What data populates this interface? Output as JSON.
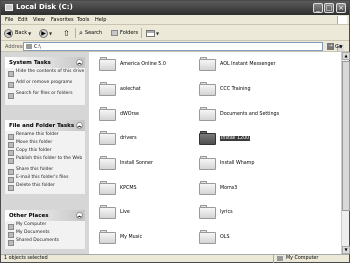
{
  "window": {
    "title": "Local Disk (C:)"
  },
  "window_buttons": {
    "minimize": "_",
    "maximize": "□",
    "close": "×"
  },
  "menu": [
    "File",
    "Edit",
    "View",
    "Favorites",
    "Tools",
    "Help"
  ],
  "toolbar": {
    "back_label": "Back",
    "search_label": "Search",
    "folders_label": "Folders"
  },
  "address": {
    "label": "Address",
    "value": "C:\\",
    "go_label": "Go"
  },
  "tasks": {
    "system": {
      "title": "System Tasks",
      "items": [
        "Hide the contents of this drive",
        "Add or remove programs",
        "Search for files or folders"
      ]
    },
    "file_folder": {
      "title": "File and Folder Tasks",
      "items": [
        "Rename this folder",
        "Move this folder",
        "Copy this folder",
        "Publish this folder to the Web",
        "Share this folder",
        "E-mail this folder's files",
        "Delete this folder"
      ]
    },
    "other": {
      "title": "Other Places",
      "items": [
        "My Computer",
        "My Documents",
        "Shared Documents"
      ]
    }
  },
  "folders": [
    {
      "name": "America Online 5.0",
      "selected": false
    },
    {
      "name": "AOL Instant Messenger",
      "selected": false
    },
    {
      "name": "aolechat",
      "selected": false
    },
    {
      "name": "CCC Training",
      "selected": false
    },
    {
      "name": "dWOrse",
      "selected": false
    },
    {
      "name": "Documents and Settings",
      "selected": false
    },
    {
      "name": "drivers",
      "selected": false
    },
    {
      "name": "Install 1200",
      "selected": true
    },
    {
      "name": "Install Sonner",
      "selected": false
    },
    {
      "name": "Install Whamp",
      "selected": false
    },
    {
      "name": "KPCMS",
      "selected": false
    },
    {
      "name": "Moms3",
      "selected": false
    },
    {
      "name": "Live",
      "selected": false
    },
    {
      "name": "lyrics",
      "selected": false
    },
    {
      "name": "My Music",
      "selected": false
    },
    {
      "name": "OLS",
      "selected": false
    }
  ],
  "status": {
    "left": "1 objects selected",
    "right": "My Computer"
  }
}
